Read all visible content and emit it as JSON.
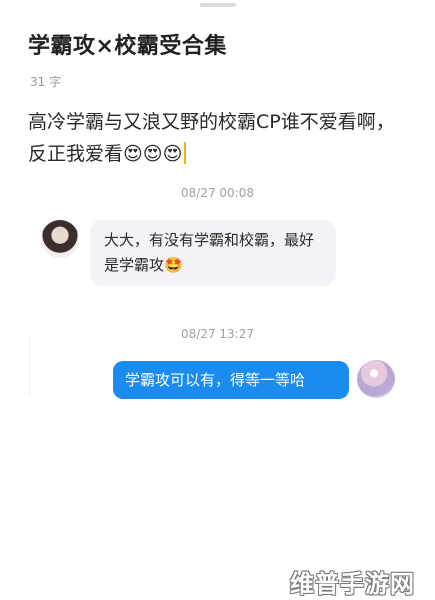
{
  "post": {
    "title": "学霸攻×校霸受合集",
    "char_count": "31 字",
    "body": "高冷学霸与又浪又野的校霸CP谁不爱看啊，反正我爱看😍😍😍"
  },
  "chat": {
    "messages": [
      {
        "timestamp": "08/27 00:08",
        "side": "left",
        "avatar_icon": "user-avatar-icon",
        "text": "大大，有没有学霸和校霸，最好是学霸攻🤩"
      },
      {
        "timestamp": "08/27 13:27",
        "side": "right",
        "avatar_icon": "author-avatar-icon",
        "text": "学霸攻可以有，得等一等哈"
      }
    ]
  },
  "watermark": "维普手游网",
  "colors": {
    "accent": "#1a8cf0",
    "caret": "#f5b400",
    "incoming_bubble": "#f4f1f7"
  }
}
